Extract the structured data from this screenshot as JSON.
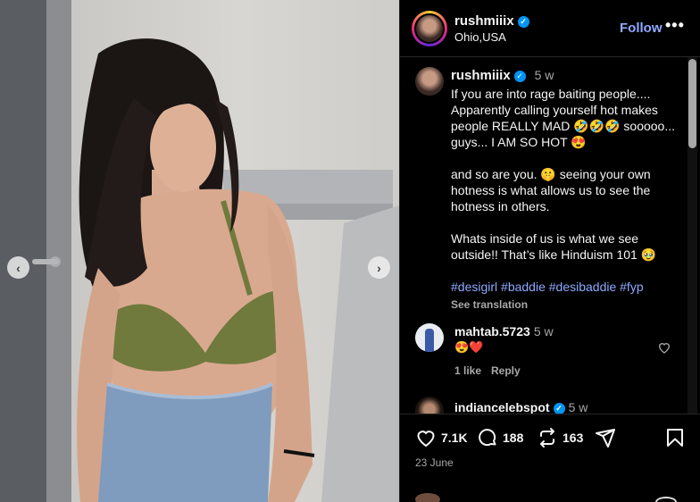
{
  "header": {
    "username": "rushmiiix",
    "location": "Ohio,USA",
    "follow_label": "Follow",
    "more_label": "•••"
  },
  "caption": {
    "username": "rushmiiix",
    "time": "5 w",
    "para1": "If you are into rage baiting people.... Apparently calling yourself hot makes people REALLY MAD 🤣🤣🤣 sooooo... guys... I AM SO HOT 😍",
    "para2": "and so are you. 🤫 seeing your own hotness is what allows us to see the hotness in others.",
    "para3": "Whats inside of us is what we see outside!! That’s like Hinduism 101 🥹",
    "hashtags": "#desigirl #baddie #desibaddie #fyp",
    "see_translation": "See translation"
  },
  "comments": [
    {
      "username": "mahtab.5723",
      "time": "5 w",
      "text": "😍❤️",
      "likes": "1 like",
      "reply": "Reply"
    },
    {
      "username": "indiancelebspot",
      "time": "5 w"
    }
  ],
  "actions": {
    "likes": "7.1K",
    "comments": "188",
    "reposts": "163",
    "date": "23 June"
  },
  "carousel": {
    "prev": "‹",
    "next": "›"
  },
  "colors": {
    "accent": "#0095f6",
    "link": "#8fa9ff",
    "muted": "#a8a8a8"
  },
  "icons": [
    "verified-badge-icon",
    "heart-icon",
    "comment-icon",
    "repost-icon",
    "share-icon",
    "bookmark-icon"
  ]
}
